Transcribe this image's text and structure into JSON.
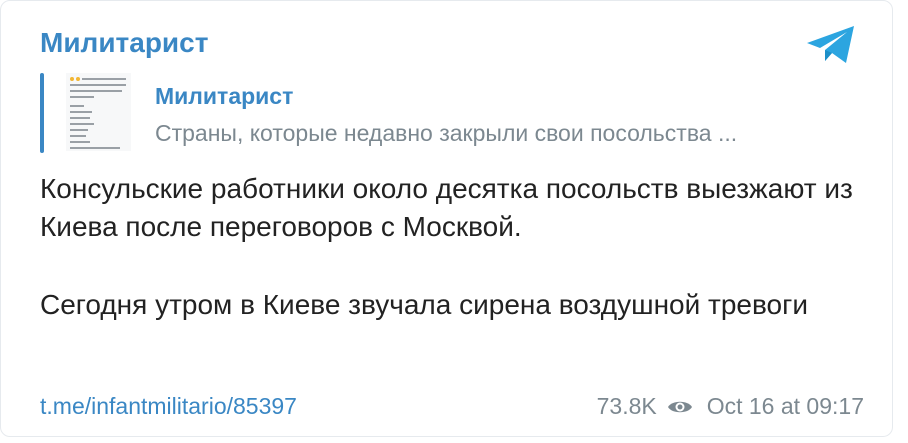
{
  "post": {
    "channel_name": "Милитарист",
    "reply": {
      "title": "Милитарист",
      "text": "Страны, которые недавно закрыли свои посольства ..."
    },
    "message": {
      "paragraph_1": "Консульские работники около десятка посольств выезжают из Киева после переговоров с Москвой.",
      "paragraph_2": "Сегодня утром в Киеве звучала сирена воздушной тревоги"
    },
    "footer": {
      "link": "t.me/infantmilitario/85397",
      "views": "73.8K",
      "date": "Oct 16 at 09:17"
    }
  },
  "colors": {
    "accent": "#3a87c4",
    "muted": "#7c8890",
    "text": "#222222",
    "telegram_blue": "#2ca5e0"
  },
  "icons": {
    "telegram": "telegram-paper-plane-icon",
    "views": "eye-icon"
  }
}
